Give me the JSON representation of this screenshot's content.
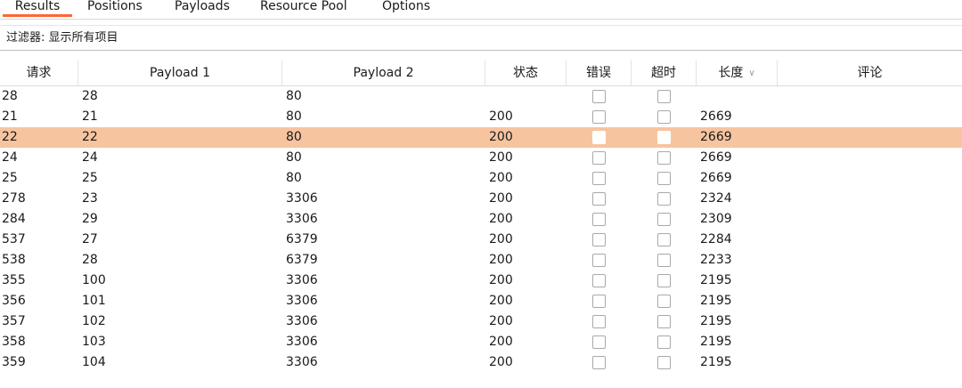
{
  "tabs": [
    {
      "label": "Results",
      "active": true
    },
    {
      "label": "Positions",
      "active": false
    },
    {
      "label": "Payloads",
      "active": false
    },
    {
      "label": "Resource Pool",
      "active": false
    },
    {
      "label": "Options",
      "active": false
    }
  ],
  "filter": {
    "label": "过滤器: 显示所有项目"
  },
  "columns": {
    "request": "请求",
    "payload1": "Payload 1",
    "payload2": "Payload 2",
    "status": "状态",
    "error": "错误",
    "timeout": "超时",
    "length": "长度",
    "comment": "评论"
  },
  "rows": [
    {
      "request": "28",
      "payload1": "28",
      "payload2": "80",
      "status": "",
      "error": false,
      "timeout": false,
      "length": "",
      "comment": "",
      "selected": false
    },
    {
      "request": "21",
      "payload1": "21",
      "payload2": "80",
      "status": "200",
      "error": false,
      "timeout": false,
      "length": "2669",
      "comment": "",
      "selected": false
    },
    {
      "request": "22",
      "payload1": "22",
      "payload2": "80",
      "status": "200",
      "error": false,
      "timeout": false,
      "length": "2669",
      "comment": "",
      "selected": true
    },
    {
      "request": "24",
      "payload1": "24",
      "payload2": "80",
      "status": "200",
      "error": false,
      "timeout": false,
      "length": "2669",
      "comment": "",
      "selected": false
    },
    {
      "request": "25",
      "payload1": "25",
      "payload2": "80",
      "status": "200",
      "error": false,
      "timeout": false,
      "length": "2669",
      "comment": "",
      "selected": false
    },
    {
      "request": "278",
      "payload1": "23",
      "payload2": "3306",
      "status": "200",
      "error": false,
      "timeout": false,
      "length": "2324",
      "comment": "",
      "selected": false
    },
    {
      "request": "284",
      "payload1": "29",
      "payload2": "3306",
      "status": "200",
      "error": false,
      "timeout": false,
      "length": "2309",
      "comment": "",
      "selected": false
    },
    {
      "request": "537",
      "payload1": "27",
      "payload2": "6379",
      "status": "200",
      "error": false,
      "timeout": false,
      "length": "2284",
      "comment": "",
      "selected": false
    },
    {
      "request": "538",
      "payload1": "28",
      "payload2": "6379",
      "status": "200",
      "error": false,
      "timeout": false,
      "length": "2233",
      "comment": "",
      "selected": false
    },
    {
      "request": "355",
      "payload1": "100",
      "payload2": "3306",
      "status": "200",
      "error": false,
      "timeout": false,
      "length": "2195",
      "comment": "",
      "selected": false
    },
    {
      "request": "356",
      "payload1": "101",
      "payload2": "3306",
      "status": "200",
      "error": false,
      "timeout": false,
      "length": "2195",
      "comment": "",
      "selected": false
    },
    {
      "request": "357",
      "payload1": "102",
      "payload2": "3306",
      "status": "200",
      "error": false,
      "timeout": false,
      "length": "2195",
      "comment": "",
      "selected": false
    },
    {
      "request": "358",
      "payload1": "103",
      "payload2": "3306",
      "status": "200",
      "error": false,
      "timeout": false,
      "length": "2195",
      "comment": "",
      "selected": false
    },
    {
      "request": "359",
      "payload1": "104",
      "payload2": "3306",
      "status": "200",
      "error": false,
      "timeout": false,
      "length": "2195",
      "comment": "",
      "selected": false
    }
  ],
  "icons": {
    "sort": "chevron-down-icon",
    "checkbox": "checkbox-icon"
  },
  "colors": {
    "accent": "#ff6633",
    "selected_row": "#f7c4a0"
  }
}
